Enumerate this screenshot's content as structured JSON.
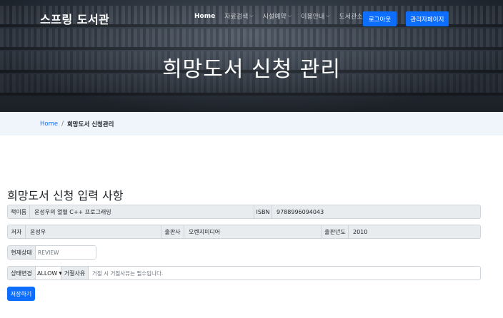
{
  "brand": "스프링 도서관",
  "nav": {
    "items": [
      {
        "label": "Home",
        "dropdown": false
      },
      {
        "label": "자료검색",
        "dropdown": true
      },
      {
        "label": "시설예약",
        "dropdown": true
      },
      {
        "label": "이용안내",
        "dropdown": true
      },
      {
        "label": "도서관소식",
        "dropdown": true
      }
    ],
    "logout_label": "로그아웃",
    "admin_label": "관리자페이지"
  },
  "hero": {
    "title": "희망도서 신청 관리"
  },
  "breadcrumb": {
    "home": "Home",
    "separator": "/",
    "current": "희망도서 신청관리"
  },
  "form": {
    "title": "희망도서 신청 입력 사항",
    "book_name_label": "책이름",
    "book_name": "윤성우의 열혈 C++ 프로그래밍",
    "isbn_label": "ISBN",
    "isbn": "9788996094043",
    "author_label": "저자",
    "author": "윤성우",
    "publisher_label": "출판사",
    "publisher": "오렌지미디어",
    "year_label": "출판년도",
    "year": "2010",
    "status_label": "현재상태",
    "status_value": "REVIEW",
    "change_label": "상태변경",
    "change_selected": "ALLOW",
    "reject_label": "거절사유",
    "reject_placeholder": "거절 시 거절사유는 필수입니다.",
    "save_label": "저장하기"
  },
  "colors": {
    "primary": "#0d6efd",
    "crumb_bg": "#f0f4fb",
    "field_bg": "#e9ecef"
  }
}
